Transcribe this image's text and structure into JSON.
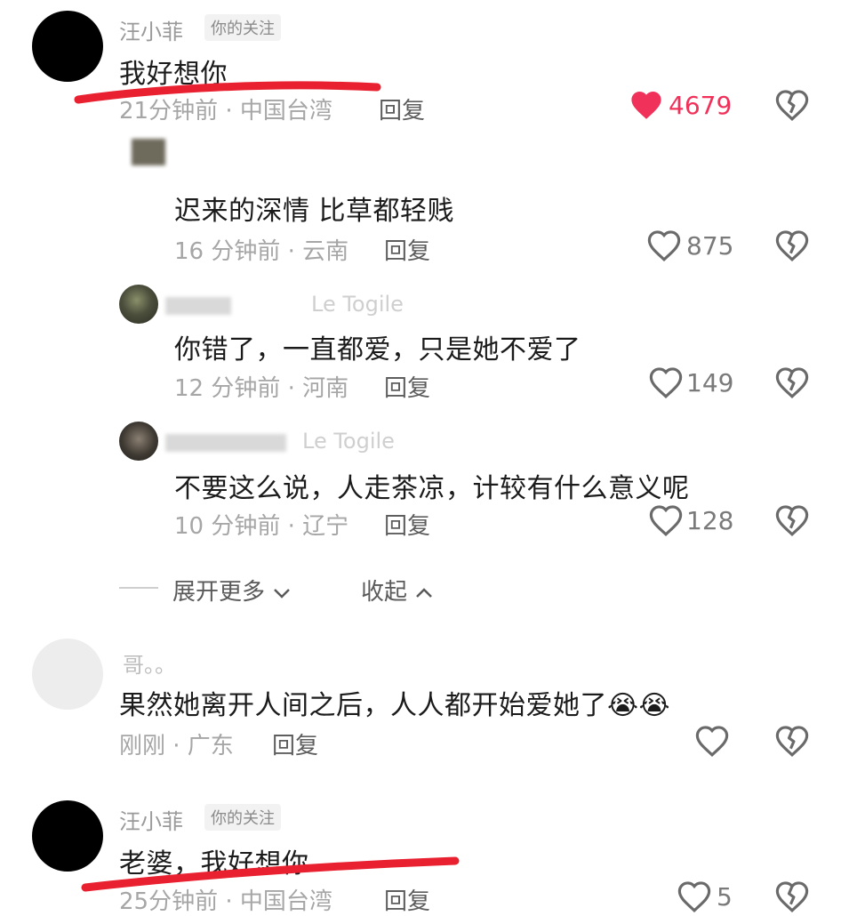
{
  "comments": [
    {
      "author": "汪小菲",
      "badge": "你的关注",
      "text": "我好想你",
      "time_location": "21分钟前 · 中国台湾",
      "reply": "回复",
      "likes": "4679",
      "liked": true
    },
    {
      "text": "迟来的深情  比草都轻贱",
      "time_location": "16 分钟前 · 云南",
      "reply": "回复",
      "likes": "875"
    },
    {
      "author_faded": "Le Togile",
      "text": "你错了，一直都爱，只是她不爱了",
      "time_location": "12 分钟前 · 河南",
      "reply": "回复",
      "likes": "149"
    },
    {
      "author_faded": "Le Togile",
      "text": "不要这么说，人走茶凉，计较有什么意义呢",
      "time_location": "10 分钟前 · 辽宁",
      "reply": "回复",
      "likes": "128"
    },
    {
      "author_faded": "哥。。",
      "text": "果然她离开人间之后，人人都开始爱她了😭😭",
      "time_location": "刚刚 · 广东",
      "reply": "回复",
      "likes": ""
    },
    {
      "author": "汪小菲",
      "badge": "你的关注",
      "text": "老婆，我好想你",
      "time_location": "25分钟前 · 中国台湾",
      "reply": "回复",
      "likes": "5"
    }
  ],
  "thread_controls": {
    "expand_more": "展开更多",
    "collapse": "收起"
  },
  "colors": {
    "like_red": "#f0315a",
    "underline_red": "#e8202f",
    "meta_grey": "#a6a6a6"
  },
  "icons": {
    "heart": "heart-icon",
    "heart_filled": "heart-filled-icon",
    "dislike": "broken-heart-icon",
    "chevron_down": "chevron-down-icon",
    "chevron_up": "chevron-up-icon"
  }
}
